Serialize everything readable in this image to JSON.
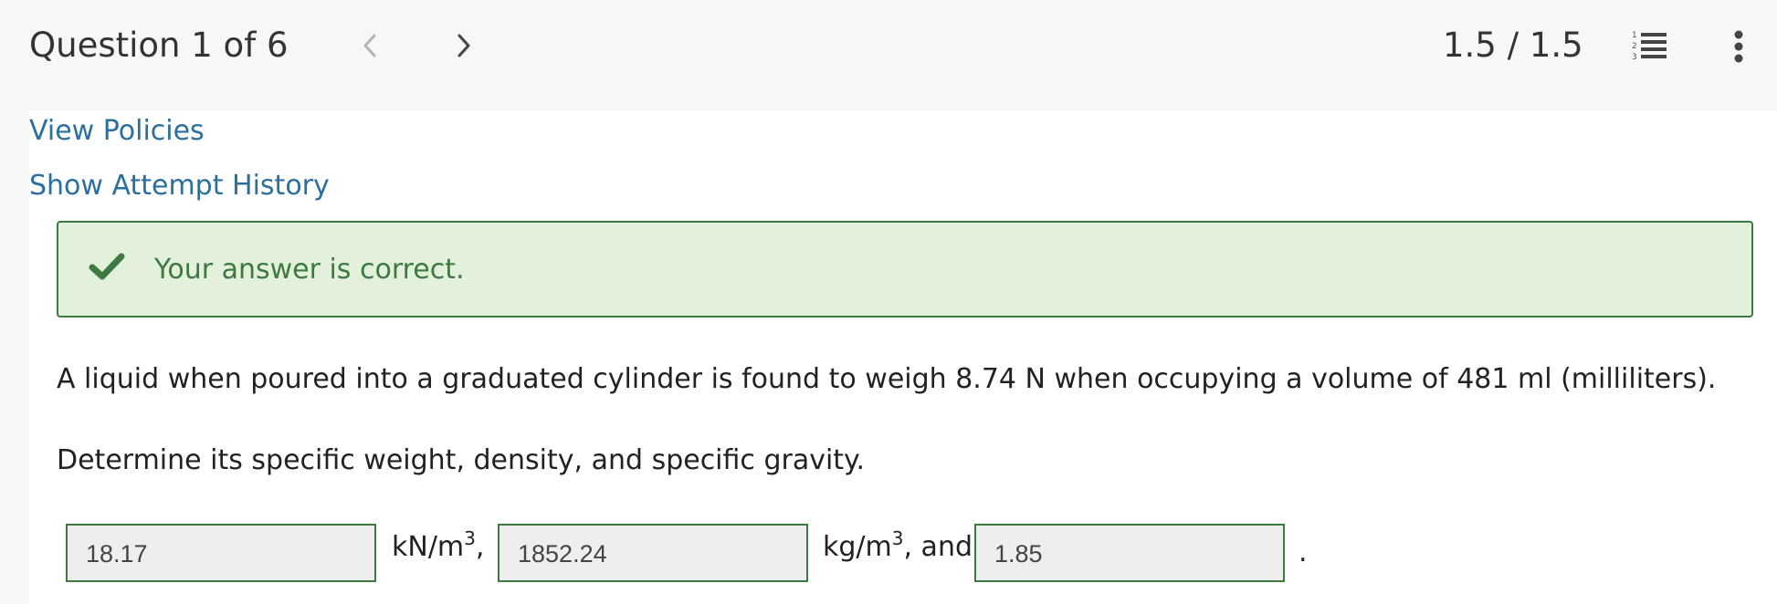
{
  "header": {
    "question_title": "Question 1 of 6",
    "score": "1.5 / 1.5",
    "prev_icon": "chevron-left-icon",
    "next_icon": "chevron-right-icon",
    "list_icon": "numbered-list-icon",
    "more_icon": "more-vertical-icon"
  },
  "links": {
    "view_policies": "View Policies",
    "show_attempt_history": "Show Attempt History"
  },
  "feedback": {
    "message": "Your answer is correct.",
    "icon": "check-icon",
    "color": "#3c7a40",
    "background": "#e3f0dc"
  },
  "question": {
    "line1": "A liquid when poured into a graduated cylinder is found to weigh 8.74 N when occupying a volume of 481 ml (milliliters).",
    "line2": "Determine its specific weight, density, and specific gravity."
  },
  "answers": {
    "specific_weight_value": "18.17",
    "specific_weight_unit": "kN/m",
    "specific_weight_exp": "3",
    "specific_weight_sep": ",",
    "density_value": "1852.24",
    "density_unit": "kg/m",
    "density_exp": "3",
    "density_sep": ", and",
    "specific_gravity_value": "1.85",
    "terminal": "."
  },
  "colors": {
    "link": "#2b6f9e",
    "header_bg": "#f7f7f7",
    "input_border": "#3c7a40"
  }
}
